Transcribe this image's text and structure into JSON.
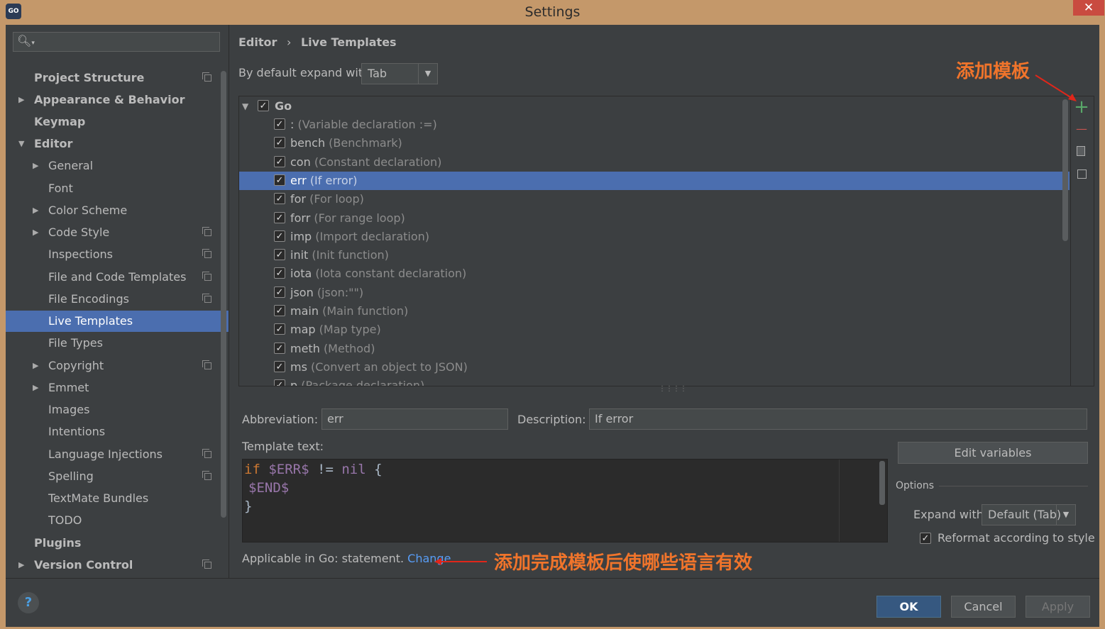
{
  "window": {
    "title": "Settings",
    "close": "✕",
    "app_icon": "GO"
  },
  "sidebar": {
    "search_placeholder": "",
    "items": [
      {
        "label": "Project Structure",
        "bold": true,
        "icon": true
      },
      {
        "label": "Appearance & Behavior",
        "bold": true,
        "arrow": "▶"
      },
      {
        "label": "Keymap",
        "bold": true
      },
      {
        "label": "Editor",
        "bold": true,
        "arrow": "▼"
      },
      {
        "label": "General",
        "arrow": "▶"
      },
      {
        "label": "Font"
      },
      {
        "label": "Color Scheme",
        "arrow": "▶"
      },
      {
        "label": "Code Style",
        "arrow": "▶",
        "icon": true
      },
      {
        "label": "Inspections",
        "icon": true
      },
      {
        "label": "File and Code Templates",
        "icon": true
      },
      {
        "label": "File Encodings",
        "icon": true
      },
      {
        "label": "Live Templates",
        "selected": true
      },
      {
        "label": "File Types"
      },
      {
        "label": "Copyright",
        "arrow": "▶",
        "icon": true
      },
      {
        "label": "Emmet",
        "arrow": "▶"
      },
      {
        "label": "Images"
      },
      {
        "label": "Intentions"
      },
      {
        "label": "Language Injections",
        "icon": true
      },
      {
        "label": "Spelling",
        "icon": true
      },
      {
        "label": "TextMate Bundles"
      },
      {
        "label": "TODO"
      },
      {
        "label": "Plugins",
        "bold": true
      },
      {
        "label": "Version Control",
        "bold": true,
        "arrow": "▶",
        "icon": true
      }
    ]
  },
  "breadcrumb": {
    "parent": "Editor",
    "separator": "›",
    "current": "Live Templates"
  },
  "expand": {
    "label": "By default expand with",
    "value": "Tab"
  },
  "tree": {
    "group": {
      "label": "Go",
      "arrow": "▼",
      "check": "✓"
    },
    "items": [
      {
        "abbr": ":",
        "desc": "(Variable declaration :=)"
      },
      {
        "abbr": "bench",
        "desc": "(Benchmark)"
      },
      {
        "abbr": "con",
        "desc": "(Constant declaration)"
      },
      {
        "abbr": "err",
        "desc": "(If error)",
        "selected": true
      },
      {
        "abbr": "for",
        "desc": "(For loop)"
      },
      {
        "abbr": "forr",
        "desc": "(For range loop)"
      },
      {
        "abbr": "imp",
        "desc": "(Import declaration)"
      },
      {
        "abbr": "init",
        "desc": "(Init function)"
      },
      {
        "abbr": "iota",
        "desc": "(Iota constant declaration)"
      },
      {
        "abbr": "json",
        "desc": "(json:\"\")"
      },
      {
        "abbr": "main",
        "desc": "(Main function)"
      },
      {
        "abbr": "map",
        "desc": "(Map type)"
      },
      {
        "abbr": "meth",
        "desc": "(Method)"
      },
      {
        "abbr": "ms",
        "desc": "(Convert an object to JSON)"
      },
      {
        "abbr": "p",
        "desc": "(Package declaration)"
      }
    ]
  },
  "toolbar": {
    "add": "+",
    "remove": "—"
  },
  "annotations": {
    "add_template": "添加模板",
    "applicable": "添加完成模板后使哪些语言有效"
  },
  "form": {
    "abbreviation_label": "Abbreviation:",
    "abbreviation_value": "err",
    "description_label": "Description:",
    "description_value": "If error",
    "template_text_label": "Template text:",
    "code": {
      "line1_kw": "if",
      "line1_var": "$ERR$",
      "line1_op": "!=",
      "line1_nil": "nil",
      "line1_brace": "{",
      "line2_var": "$END$",
      "line3": "}"
    },
    "edit_variables": "Edit variables",
    "options_label": "Options",
    "expand_with_label": "Expand with",
    "expand_with_value": "Default (Tab)",
    "reformat_label": "Reformat according to style",
    "reformat_checked": true,
    "applicable_text": "Applicable in Go: statement.",
    "change_link": "Change"
  },
  "buttons": {
    "ok": "OK",
    "cancel": "Cancel",
    "apply": "Apply",
    "help": "?"
  },
  "colors": {
    "accent": "#4b6eaf",
    "annotation": "#f0742b",
    "keyword": "#cc7832",
    "variable": "#9876aa",
    "link": "#589df6",
    "add": "#59a869",
    "remove": "#c75450"
  }
}
